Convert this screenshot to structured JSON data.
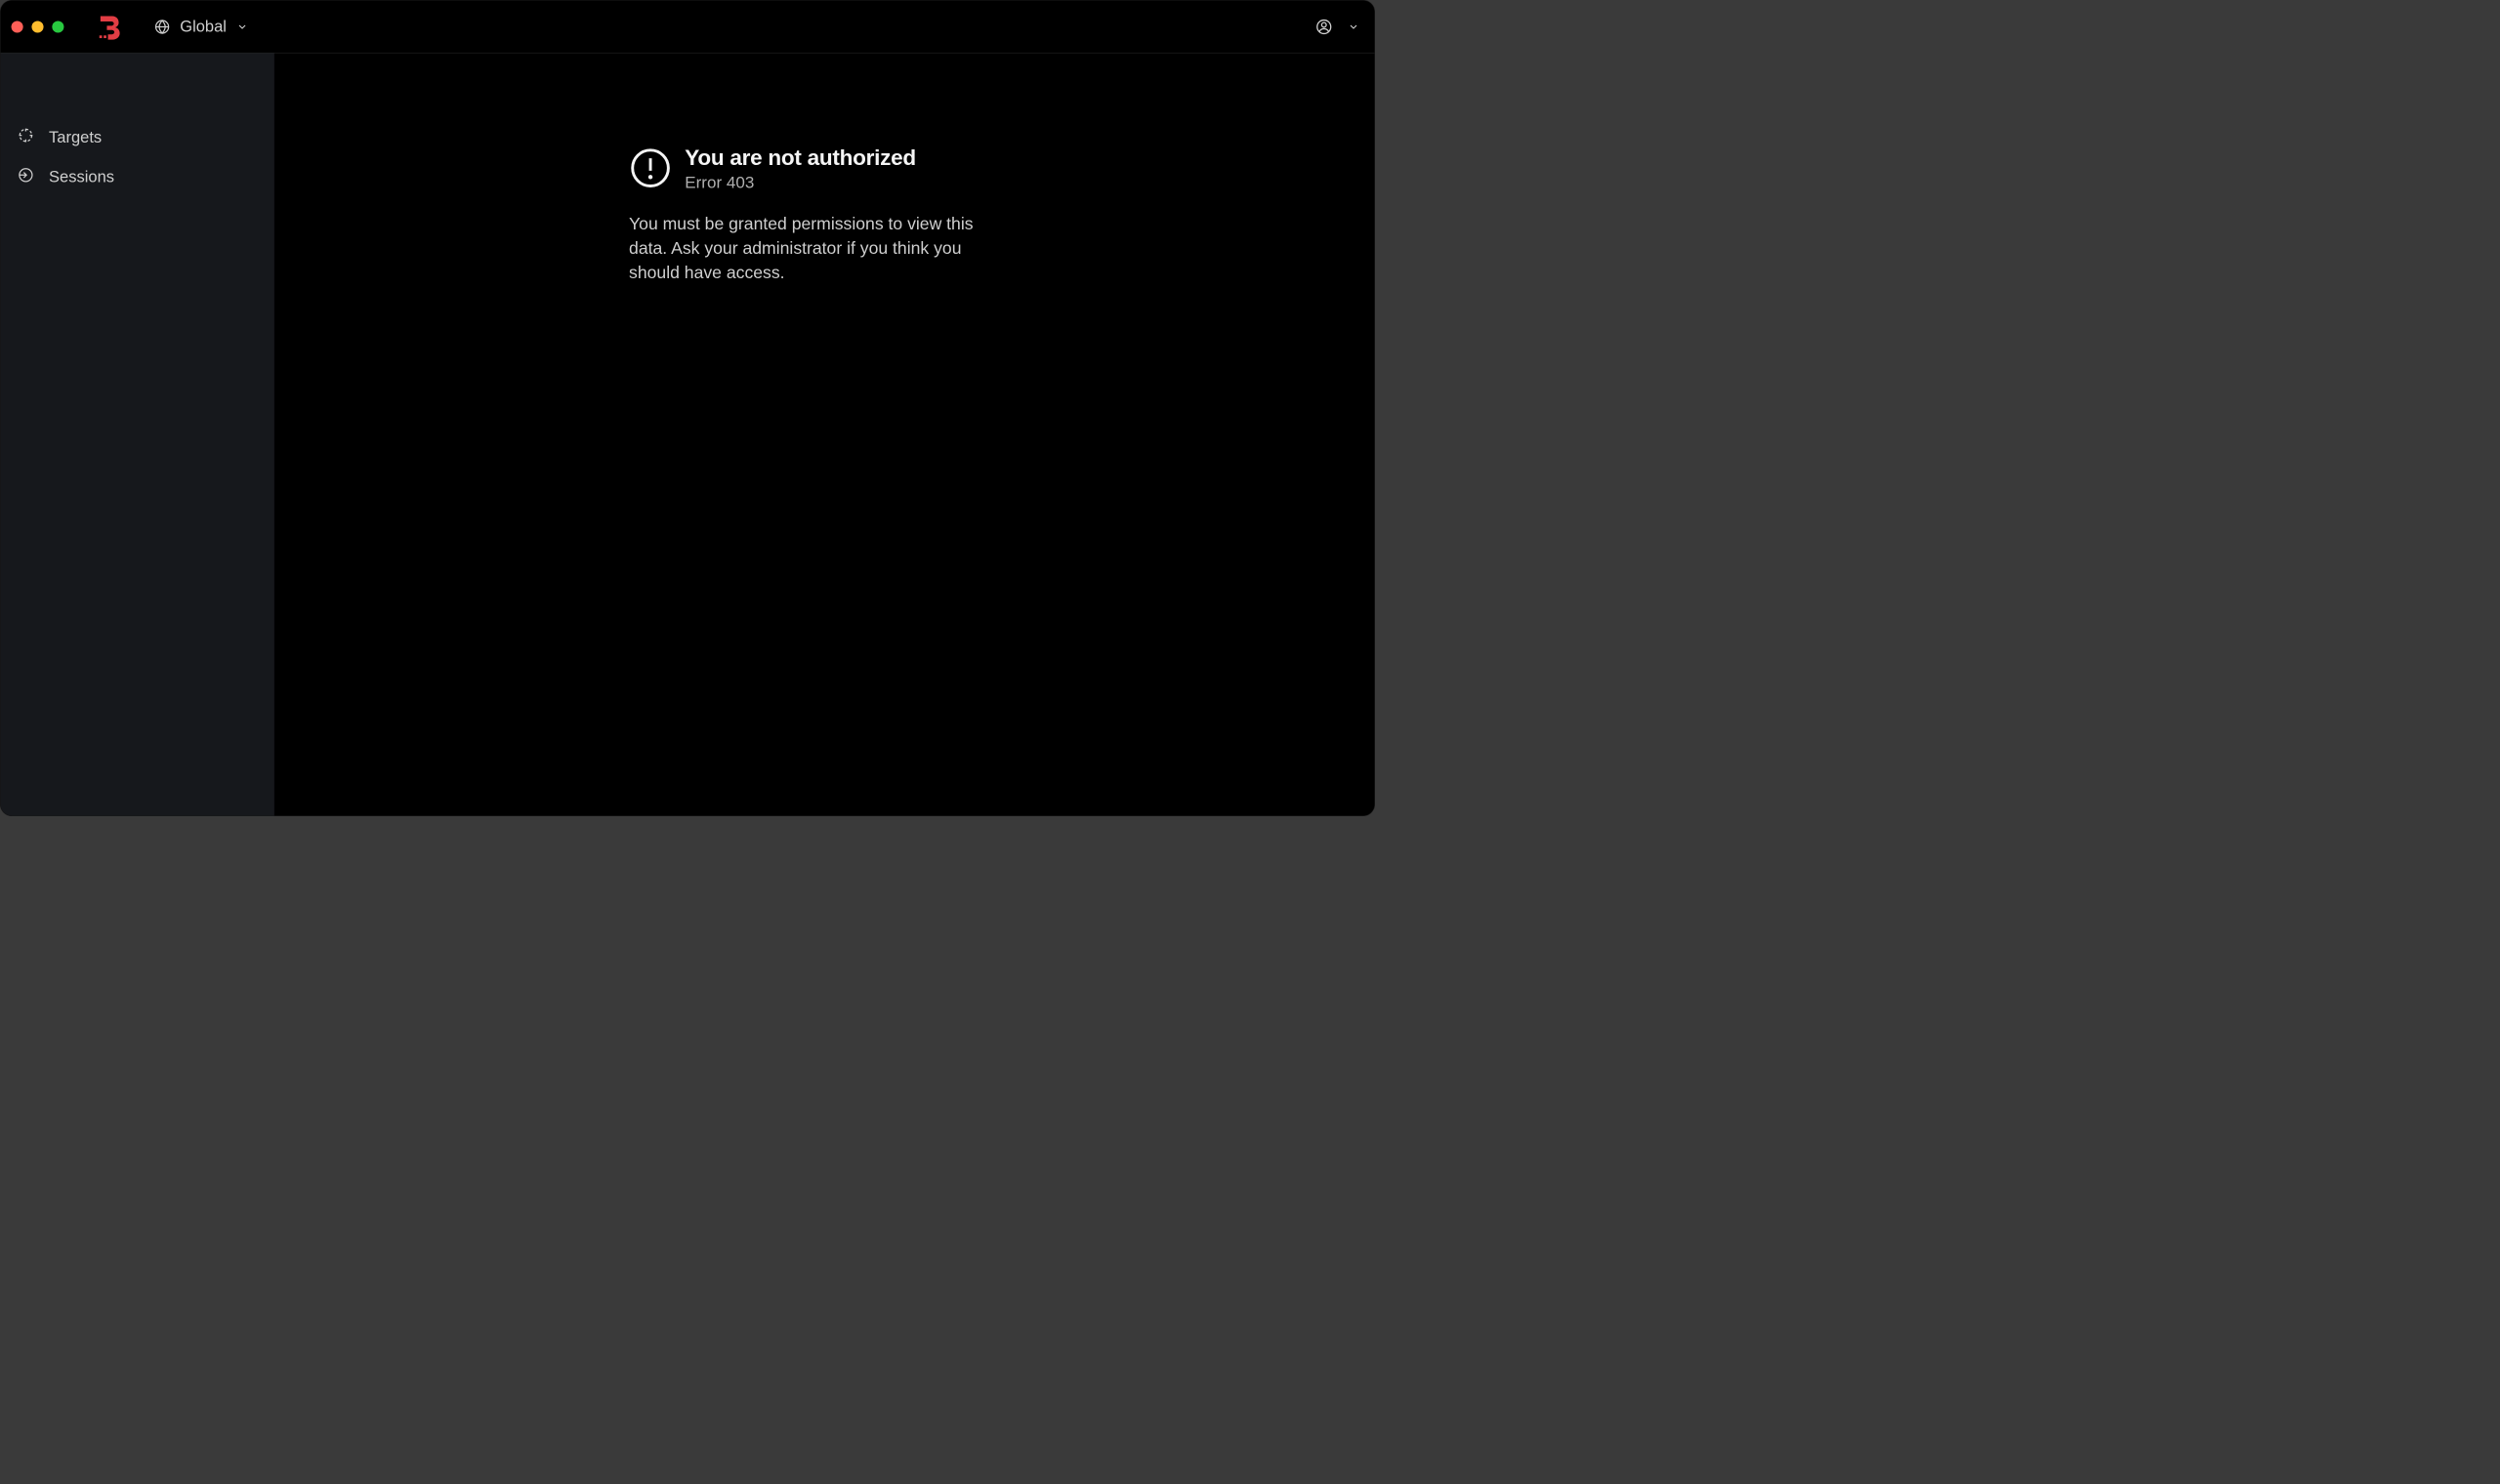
{
  "header": {
    "scope_label": "Global"
  },
  "sidebar": {
    "items": [
      {
        "label": "Targets",
        "icon": "crosshair-icon"
      },
      {
        "label": "Sessions",
        "icon": "enter-icon"
      }
    ]
  },
  "error": {
    "title": "You are not authorized",
    "subtitle": "Error 403",
    "description": "You must be granted permissions to view this data. Ask your administrator if you think you should have access."
  },
  "colors": {
    "brand": "#e23d44",
    "traffic_red": "#ff5f57",
    "traffic_yellow": "#ffbd2e",
    "traffic_green": "#28c840"
  }
}
